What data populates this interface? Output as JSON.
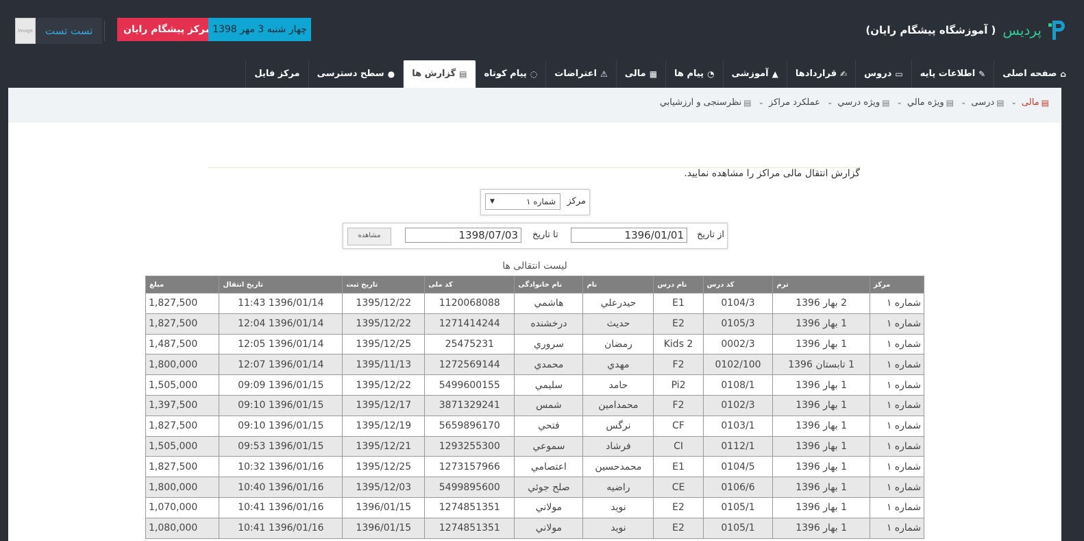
{
  "brand": {
    "name": "پرديس",
    "subtitle": "( آموزشگاه پيشگام رايان)"
  },
  "user": {
    "name": "تست تست",
    "avatar_text": "image"
  },
  "center_badge": "مركز پيشگام رايان",
  "date_badge": "چهار شنبه 3 مهر 1398",
  "mainnav": [
    {
      "label": "صفحه اصلی",
      "icon": "home-icon"
    },
    {
      "label": "اطلاعات پایه",
      "icon": "wrench-icon"
    },
    {
      "label": "دروس",
      "icon": "folder-icon"
    },
    {
      "label": "قراردادها",
      "icon": "edit-icon"
    },
    {
      "label": "آموزشی",
      "icon": "graduation-cap-icon"
    },
    {
      "label": "پیام ها",
      "icon": "comments-icon"
    },
    {
      "label": "مالی",
      "icon": "calculator-icon"
    },
    {
      "label": "اعتراضات",
      "icon": "warning-icon"
    },
    {
      "label": "پیام کوتاه",
      "icon": "chat-icon"
    },
    {
      "label": "گزارش ها",
      "icon": "document-icon",
      "active": true
    },
    {
      "label": "سطح دسترسی",
      "icon": "lock-icon"
    },
    {
      "label": "مرکز فایل",
      "icon": ""
    }
  ],
  "subnav": [
    {
      "label": "مالی",
      "active": true
    },
    {
      "label": "درسی"
    },
    {
      "label": "ويژه مالي"
    },
    {
      "label": "ويژه درسي"
    },
    {
      "label": "عملكرد مراكز"
    },
    {
      "label": "نظرسنجی و ارزشيابي"
    }
  ],
  "intro": "گزارش انتقال مالی مراکز را مشاهده نمایید.",
  "center_filter": {
    "label": "مرکز",
    "value": "شماره ١"
  },
  "date_filter": {
    "from_label": "از تاریخ",
    "from_value": "1396/01/01",
    "to_label": "تا تاریخ",
    "to_value": "1398/07/03",
    "button": "مشاهده"
  },
  "list_title": "لیست انتقالی ها",
  "table": {
    "headers": [
      "مرکز",
      "ترم",
      "کد درس",
      "نام درس",
      "نام",
      "نام خانوادگی",
      "کد ملی",
      "تاریخ ثبت",
      "تاریخ انتقال",
      "مبلغ"
    ],
    "rows": [
      [
        "شماره ١",
        "2 بهار 1396",
        "0104/3",
        "E1",
        "حيدرعلي",
        "هاشمي",
        "1120068088",
        "1395/12/22",
        "1396/01/14 11:43",
        "1,827,500"
      ],
      [
        "شماره ١",
        "1 بهار 1396",
        "0105/3",
        "E2",
        "حديث",
        "درخشنده",
        "1271414244",
        "1395/12/22",
        "1396/01/14 12:04",
        "1,827,500"
      ],
      [
        "شماره ١",
        "1 بهار 1396",
        "0002/3",
        "Kids 2",
        "رمضان",
        "سروري",
        "25475231",
        "1395/12/25",
        "1396/01/14 12:05",
        "1,487,500"
      ],
      [
        "شماره ١",
        "1 تابستان 1396",
        "0102/100",
        "F2",
        "مهدي",
        "محمدي",
        "1272569144",
        "1395/11/13",
        "1396/01/14 12:07",
        "1,800,000"
      ],
      [
        "شماره ١",
        "1 بهار 1396",
        "0108/1",
        "Pi2",
        "حامد",
        "سليمي",
        "5499600155",
        "1395/12/22",
        "1396/01/15 09:09",
        "1,505,000"
      ],
      [
        "شماره ١",
        "1 بهار 1396",
        "0102/3",
        "F2",
        "محمدامين",
        "شمس",
        "3871329241",
        "1395/12/17",
        "1396/01/15 09:10",
        "1,397,500"
      ],
      [
        "شماره ١",
        "1 بهار 1396",
        "0103/1",
        "CF",
        "نرگس",
        "فتحي",
        "5659896170",
        "1395/12/19",
        "1396/01/15 09:10",
        "1,827,500"
      ],
      [
        "شماره ١",
        "1 بهار 1396",
        "0112/1",
        "CI",
        "فرشاد",
        "سموعي",
        "1293255300",
        "1395/12/21",
        "1396/01/15 09:53",
        "1,505,000"
      ],
      [
        "شماره ١",
        "1 بهار 1396",
        "0104/5",
        "E1",
        "محمدحسين",
        "اعتصامي",
        "1273157966",
        "1395/12/25",
        "1396/01/16 10:32",
        "1,827,500"
      ],
      [
        "شماره ١",
        "1 بهار 1396",
        "0106/6",
        "CE",
        "راضيه",
        "صلح جوئي",
        "5499895600",
        "1395/12/03",
        "1396/01/16 10:40",
        "1,800,000"
      ],
      [
        "شماره ١",
        "1 بهار 1396",
        "0105/1",
        "E2",
        "نويد",
        "مولاني",
        "1274851351",
        "1396/01/15",
        "1396/01/16 10:41",
        "1,070,000"
      ],
      [
        "شماره ١",
        "1 بهار 1396",
        "0105/1",
        "E2",
        "نويد",
        "مولاني",
        "1274851351",
        "1396/01/15",
        "1396/01/16 10:41",
        "1,080,000"
      ]
    ]
  }
}
